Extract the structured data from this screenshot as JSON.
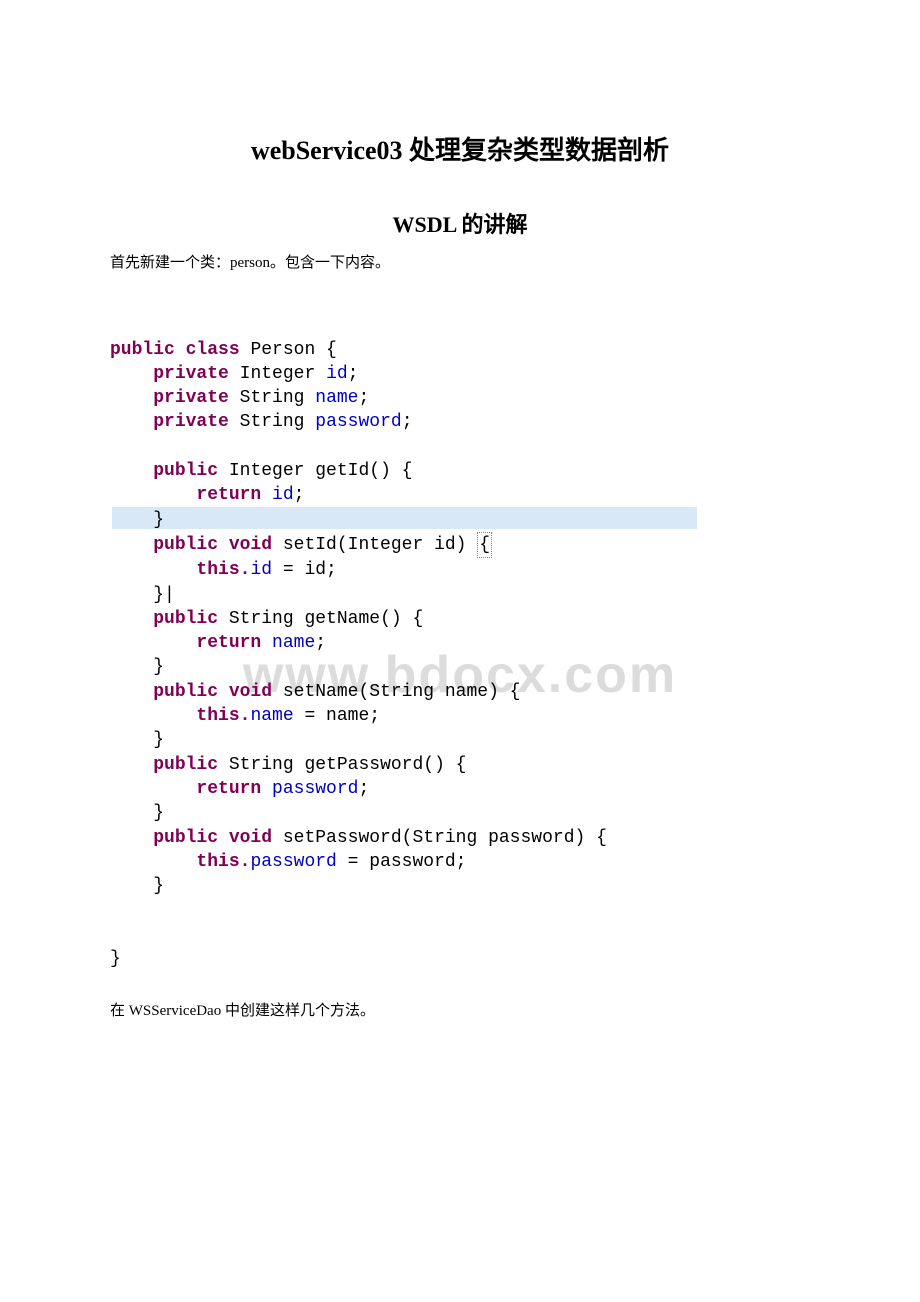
{
  "title": "webService03 处理复杂类型数据剖析",
  "subtitle": "WSDL 的讲解",
  "intro": "首先新建一个类：person。包含一下内容。",
  "outro": "在 WSServiceDao 中创建这样几个方法。",
  "watermark": "www.bdocx.com",
  "code": {
    "l1_kw": "public class ",
    "l1_txt": "Person {",
    "l2_kw": "private ",
    "l2_type": "Integer ",
    "l2_fld": "id",
    "l2_end": ";",
    "l3_kw": "private ",
    "l3_type": "String ",
    "l3_fld": "name",
    "l3_end": ";",
    "l4_kw": "private ",
    "l4_type": "String ",
    "l4_fld": "password",
    "l4_end": ";",
    "l6_kw": "public ",
    "l6_txt": "Integer getId() {",
    "l7_kw": "return ",
    "l7_fld": "id",
    "l7_end": ";",
    "l8_txt": "}",
    "l9_kw": "public void ",
    "l9_txt": "setId(Integer id) ",
    "l9_brace": "{",
    "l10_kw": "this.",
    "l10_fld": "id",
    "l10_txt": " = id;",
    "l11_txt": "}",
    "l12_kw": "public ",
    "l12_txt": "String getName() {",
    "l13_kw": "return ",
    "l13_fld": "name",
    "l13_end": ";",
    "l14_txt": "}",
    "l15_kw": "public void ",
    "l15_txt": "setName(String name) {",
    "l16_kw": "this.",
    "l16_fld": "name",
    "l16_txt": " = name;",
    "l17_txt": "}",
    "l18_kw": "public ",
    "l18_txt": "String getPassword() {",
    "l19_kw": "return ",
    "l19_fld": "password",
    "l19_end": ";",
    "l20_txt": "}",
    "l21_kw": "public void ",
    "l21_txt": "setPassword(String password) {",
    "l22_kw": "this.",
    "l22_fld": "password",
    "l22_txt": " = password;",
    "l23_txt": "}",
    "l26_txt": "}"
  }
}
